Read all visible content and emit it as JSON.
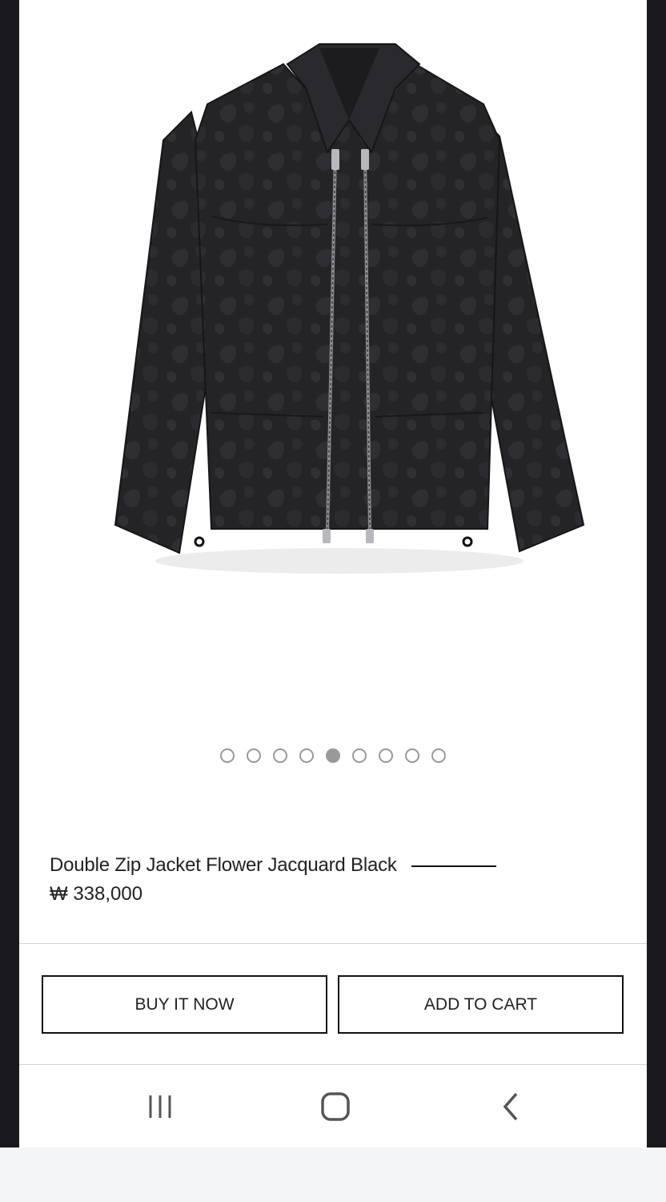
{
  "product": {
    "title": "Double Zip Jacket Flower Jacquard Black",
    "price": "₩ 338,000",
    "image_icon": "jacket-image",
    "gallery": {
      "total": 9,
      "active_index": 4
    }
  },
  "actions": {
    "buy_now_label": "BUY IT NOW",
    "add_to_cart_label": "ADD TO CART"
  },
  "navbar": {
    "recents_icon": "recents-icon",
    "home_icon": "home-icon",
    "back_icon": "back-icon"
  },
  "colors": {
    "background_frame": "#1a1a1e",
    "content": "#ffffff",
    "text": "#222222",
    "dot": "#999999",
    "button_border": "#111111"
  }
}
